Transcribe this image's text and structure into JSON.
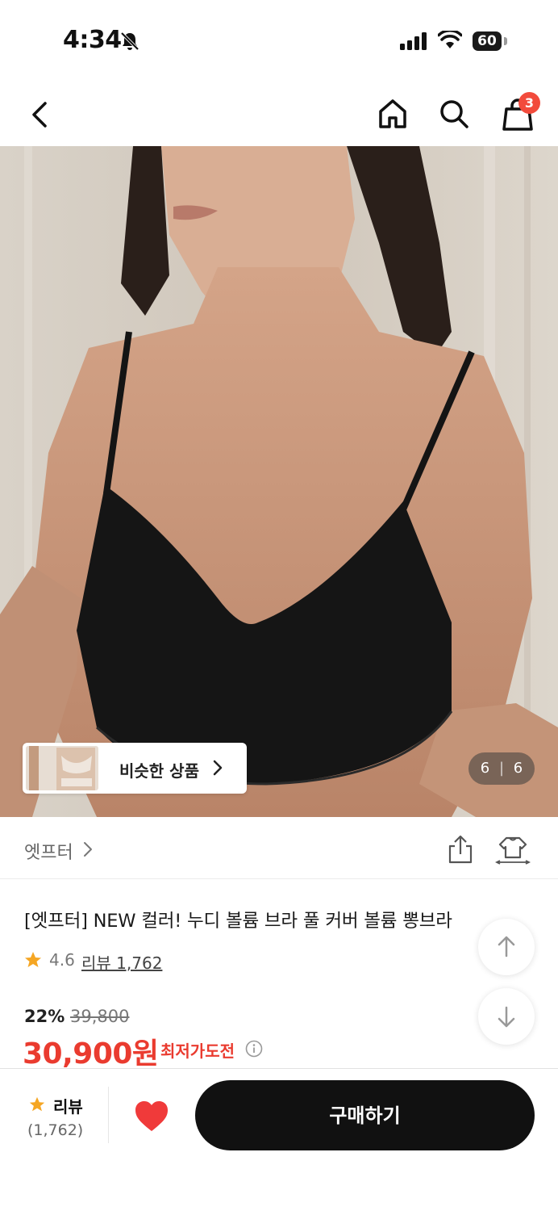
{
  "status_bar": {
    "time": "4:34",
    "battery": "60"
  },
  "nav": {
    "cart_count": "3"
  },
  "gallery": {
    "similar_label": "비슷한 상품",
    "counter_current": "6",
    "counter_total": "6",
    "counter_sep": "|"
  },
  "seller": {
    "name": "엣프터"
  },
  "product": {
    "title": "[엣프터] NEW 컬러! 누디 볼륨 브라 풀 커버 볼륨 뽕브라",
    "rating": "4.6",
    "review_link": "리뷰 1,762",
    "discount": "22%",
    "original_price": "39,800",
    "sale_price": "30,900원",
    "lowest_price_tag": "최저가도전"
  },
  "bottom_bar": {
    "review_label": "리뷰",
    "review_count": "(1,762)",
    "buy_label": "구매하기"
  },
  "colors": {
    "accent_red": "#ea3b2f",
    "badge_red": "#f24b3c",
    "star": "#f5a623",
    "heart": "#f03a3a",
    "buy_bg": "#111111"
  }
}
